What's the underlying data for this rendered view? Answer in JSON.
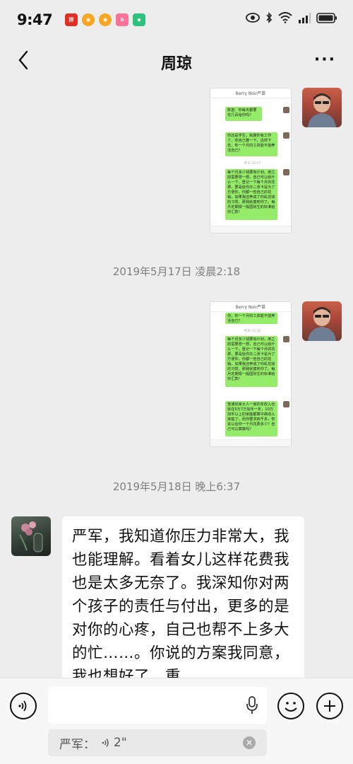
{
  "status_bar": {
    "time": "9:47",
    "apps": [
      {
        "name": "pinduoduo-app-icon",
        "color": "#e02e24"
      },
      {
        "name": "weibo-app-icon",
        "color": "#f5a623"
      },
      {
        "name": "weibo-app-icon-2",
        "color": "#f5a623"
      },
      {
        "name": "bilibili-app-icon",
        "color": "#fb7299"
      },
      {
        "name": "green-app-icon",
        "color": "#2ec27e"
      }
    ]
  },
  "header": {
    "title": "周琼",
    "more_label": "···"
  },
  "messages": {
    "screenshot1": {
      "app_title": "Berry Noir严苗",
      "bubbles": [
        "陈苗：你每天都要花几百给你吗？",
        "你还是学生，就算你有工作了，你自己算一下，这样下去，你一个月的工资能不能养活自己？",
        "每个月多少钱要有计划，用之前需要想一想，自己可以给什么一下，登记一下每个月的花费，要是给你办二张卡是为了方便你，你都一些自己的花销，如果我还养成了你乱花钱的习惯，那我就害死你了。每月定期报一般国际生的标准给你汇款！"
      ],
      "mini_time": "昨天 22:07"
    },
    "timestamp1": "2019年5月17日 凌晨2:18",
    "screenshot2": {
      "app_title": "Berry Noir严苗",
      "bubbles": [
        "你，你一个月的工资能不能养活自己？",
        "每个月多少钱要有计划，用之前需要想一想，自己可以给什么一下，登记一下每个月的花费，要是给你办二张卡是为了方便你，你都一些自己的花销，如果我还养成了你乱花钱的习惯，那我就害死你了。每月定期报一般国际生的标准给你汇款！",
        "普通加拿大人一家的年收入也就在5万7万加币一年，10万加币以上的家庭都算中高收入家庭了，而你要求四千多，你说以后你一个月花费多少？自己可以算算吗？"
      ],
      "mini_time": "昨天 22:26"
    },
    "timestamp2": "2019年5月18日 晚上6:37",
    "text_bubble": "严军，我知道你压力非常大，我也能理解。看着女儿这样花费我也是太多无奈了。我深知你对两个孩子的责任与付出，更多的是对你的心疼，自己也帮不上多大的忙……。你说的方案我同意，我也想好了，重"
  },
  "input_bar": {
    "quote_sender": "严军：",
    "quote_duration": "2\"",
    "colors": {
      "bubble_green": "#95ec69",
      "background": "#ededed"
    }
  }
}
